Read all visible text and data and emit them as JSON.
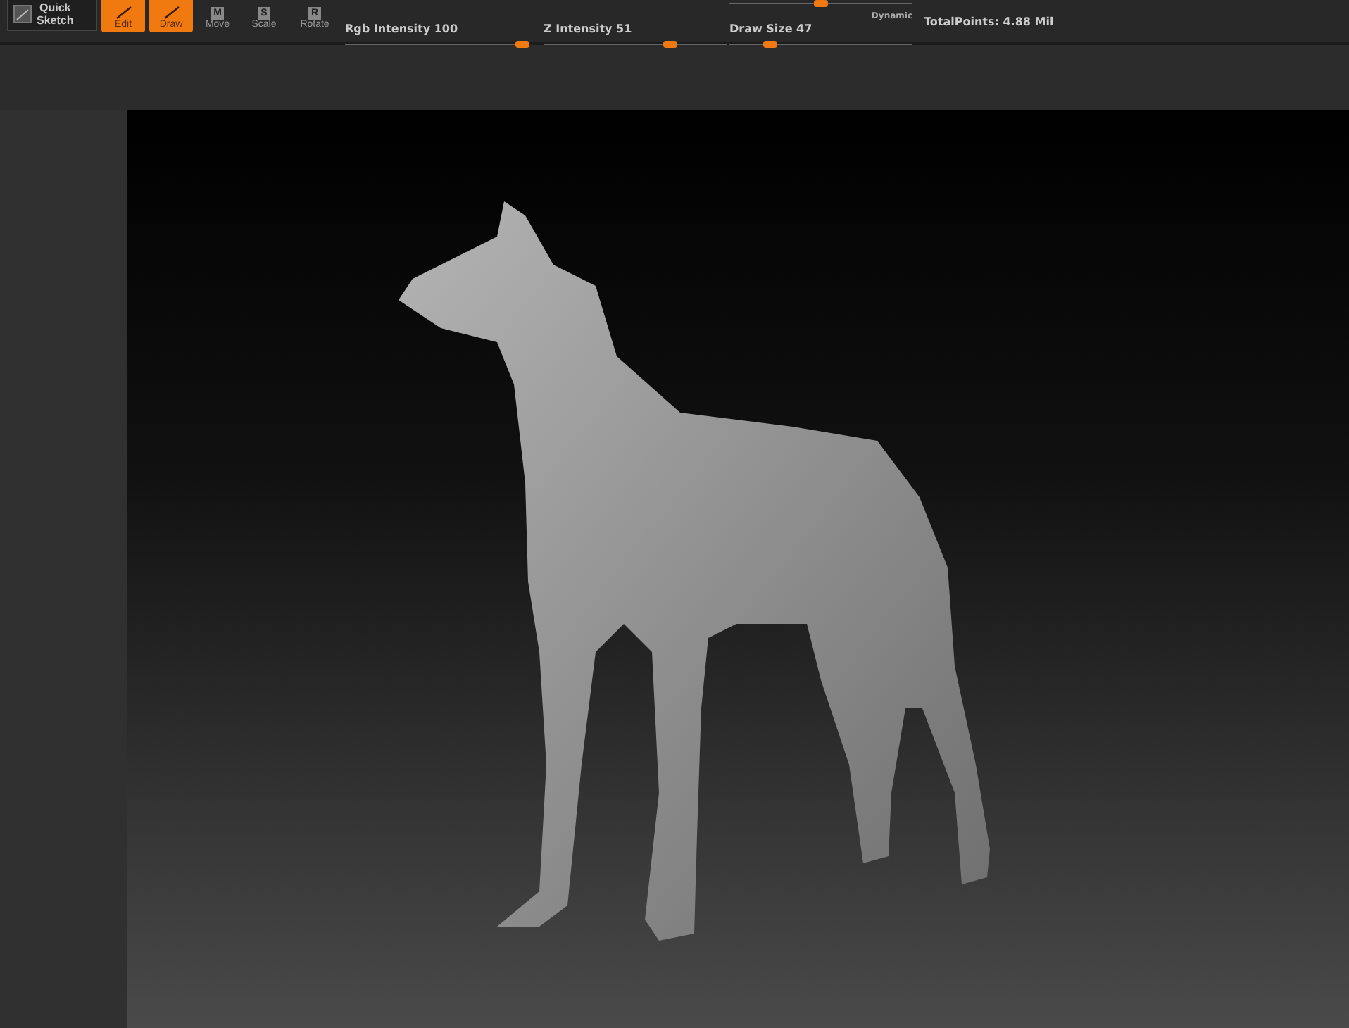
{
  "toolbar": {
    "quick_sketch": {
      "label": "Quick\nSketch"
    },
    "tools": [
      {
        "label": "Edit",
        "selected": true
      },
      {
        "label": "Draw",
        "selected": true
      },
      {
        "label": "Move",
        "hotkey": "M",
        "selected": false
      },
      {
        "label": "Scale",
        "hotkey": "S",
        "selected": false
      },
      {
        "label": "Rotate",
        "hotkey": "R",
        "selected": false
      }
    ],
    "sliders": [
      {
        "label": "Rgb Intensity 100",
        "level": 0.97
      },
      {
        "label": "Z Intensity 51",
        "level": 0.69
      },
      {
        "label": "Draw Size 47",
        "level": 0.22
      }
    ],
    "top_slider": {
      "level": 0.5
    },
    "dynamic_label": "Dynamic",
    "total_points": "TotalPoints: 4.88 Mil"
  }
}
